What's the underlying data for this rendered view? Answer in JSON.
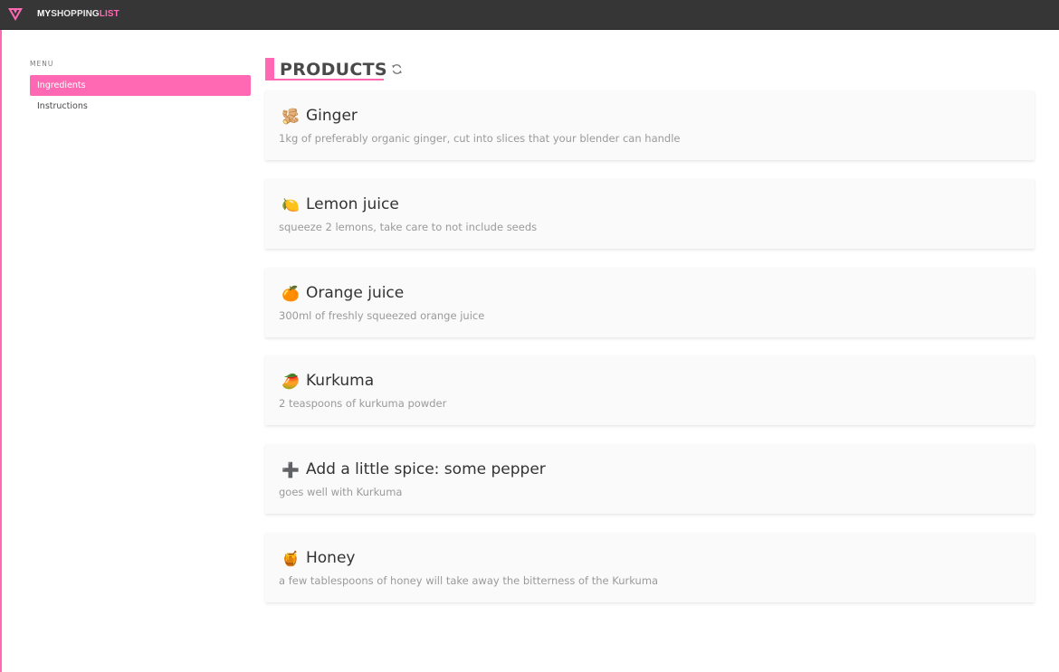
{
  "brand": {
    "part1": "MY",
    "part2": "SHOPPING",
    "part3": "LIST"
  },
  "sidebar": {
    "menu_label": "MENU",
    "items": [
      {
        "label": "Ingredients",
        "active": true
      },
      {
        "label": "Instructions",
        "active": false
      }
    ]
  },
  "main": {
    "title": "PRODUCTS",
    "refresh_icon": "refresh-icon"
  },
  "products": [
    {
      "icon": "ginger-icon",
      "emoji": "🫚",
      "name": "Ginger",
      "description": "1kg of preferably organic ginger, cut into slices that your blender can handle"
    },
    {
      "icon": "lemon-icon",
      "emoji": "🍋",
      "name": "Lemon juice",
      "description": "squeeze 2 lemons, take care to not include seeds"
    },
    {
      "icon": "orange-icon",
      "emoji": "🍊",
      "name": "Orange juice",
      "description": "300ml of freshly squeezed orange juice"
    },
    {
      "icon": "kurkuma-icon",
      "emoji": "🥭",
      "name": "Kurkuma",
      "description": "2 teaspoons of kurkuma powder"
    },
    {
      "icon": "plus-icon",
      "emoji": "➕",
      "name": "Add a little spice: some pepper",
      "description": "goes well with Kurkuma"
    },
    {
      "icon": "honey-icon",
      "emoji": "🍯",
      "name": "Honey",
      "description": "a few tablespoons of honey will take away the bitterness of the Kurkuma"
    }
  ],
  "colors": {
    "accent": "#ff69b4",
    "topbar": "#363636",
    "card_bg": "#fafafa"
  }
}
